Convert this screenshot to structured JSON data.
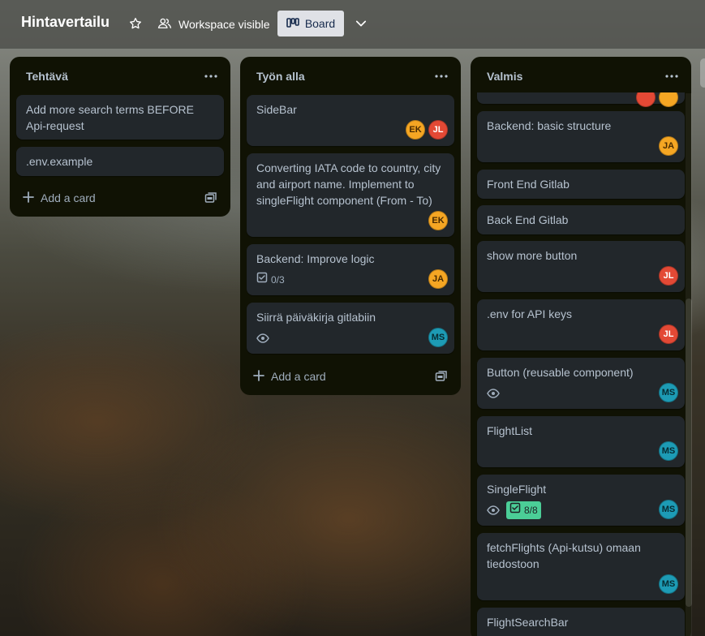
{
  "header": {
    "board_title": "Hintavertailu",
    "visibility_label": "Workspace visible",
    "view_label": "Board"
  },
  "lists": [
    {
      "title": "Tehtävä",
      "add_card_label": "Add a card",
      "cards": [
        {
          "title": "Add more search terms BEFORE Api-request"
        },
        {
          "title": ".env.example"
        }
      ]
    },
    {
      "title": "Työn alla",
      "add_card_label": "Add a card",
      "cards": [
        {
          "title": "SideBar",
          "members": [
            "EK",
            "JL"
          ]
        },
        {
          "title": "Converting IATA code to country, city and airport name. Implement to singleFlight component (From - To)",
          "members": [
            "EK"
          ]
        },
        {
          "title": "Backend: Improve logic",
          "checklist": "0/3",
          "members": [
            "JA"
          ]
        },
        {
          "title": "Siirrä päiväkirja gitlabiin",
          "watching": true,
          "members": [
            "MS"
          ]
        }
      ]
    },
    {
      "title": "Valmis",
      "cards": [
        {
          "title": "Backend: basic structure",
          "members": [
            "JA"
          ]
        },
        {
          "title": "Front End Gitlab"
        },
        {
          "title": "Back End Gitlab"
        },
        {
          "title": "show more button",
          "members": [
            "JL"
          ]
        },
        {
          "title": ".env for API keys",
          "members": [
            "JL"
          ]
        },
        {
          "title": "Button (reusable component)",
          "watching": true,
          "members": [
            "MS"
          ]
        },
        {
          "title": "FlightList",
          "members": [
            "MS"
          ]
        },
        {
          "title": "SingleFlight",
          "watching": true,
          "checklist": "8/8",
          "members": [
            "MS"
          ]
        },
        {
          "title": "fetchFlights (Api-kutsu) omaan tiedostoon",
          "members": [
            "MS"
          ]
        },
        {
          "title": "FlightSearchBar"
        }
      ]
    }
  ],
  "colors": {
    "list_bg": "#101204",
    "card_bg": "#22272b",
    "text": "#b6c2cf",
    "checklist_done": "#4bce97",
    "avatar_ek": "#f5a623",
    "avatar_jl": "#e34935",
    "avatar_ja": "#f5a623",
    "avatar_ms": "#1d9bb5"
  }
}
